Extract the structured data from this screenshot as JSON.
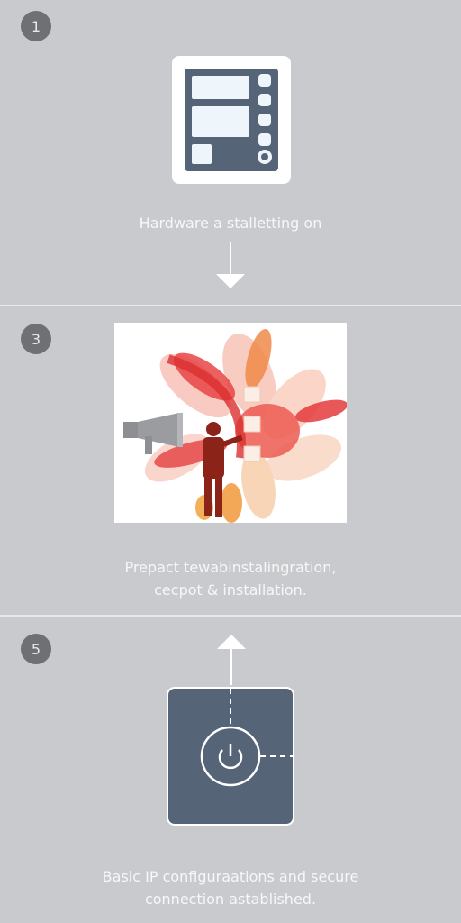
{
  "colors": {
    "background": "#c9cacd",
    "panel_dark": "#566478",
    "badge": "#6f7073",
    "caption_text": "#f7f7f8",
    "divider": "#e6e7e9"
  },
  "steps": [
    {
      "badge": "1",
      "icon": "hardware-panel-icon",
      "caption_lines": [
        "Hardware a stalletting on"
      ],
      "arrow": "arrow-down-icon"
    },
    {
      "badge": "3",
      "icon": "installation-illustration",
      "caption_lines": [
        "Prepact tewabinstalingration,",
        "cecpot & installation."
      ]
    },
    {
      "badge": "5",
      "icon": "power-icon",
      "caption_lines": [
        "Basic IP configuraations and secure",
        "connection astablished."
      ],
      "arrow": "arrow-up-icon"
    }
  ]
}
